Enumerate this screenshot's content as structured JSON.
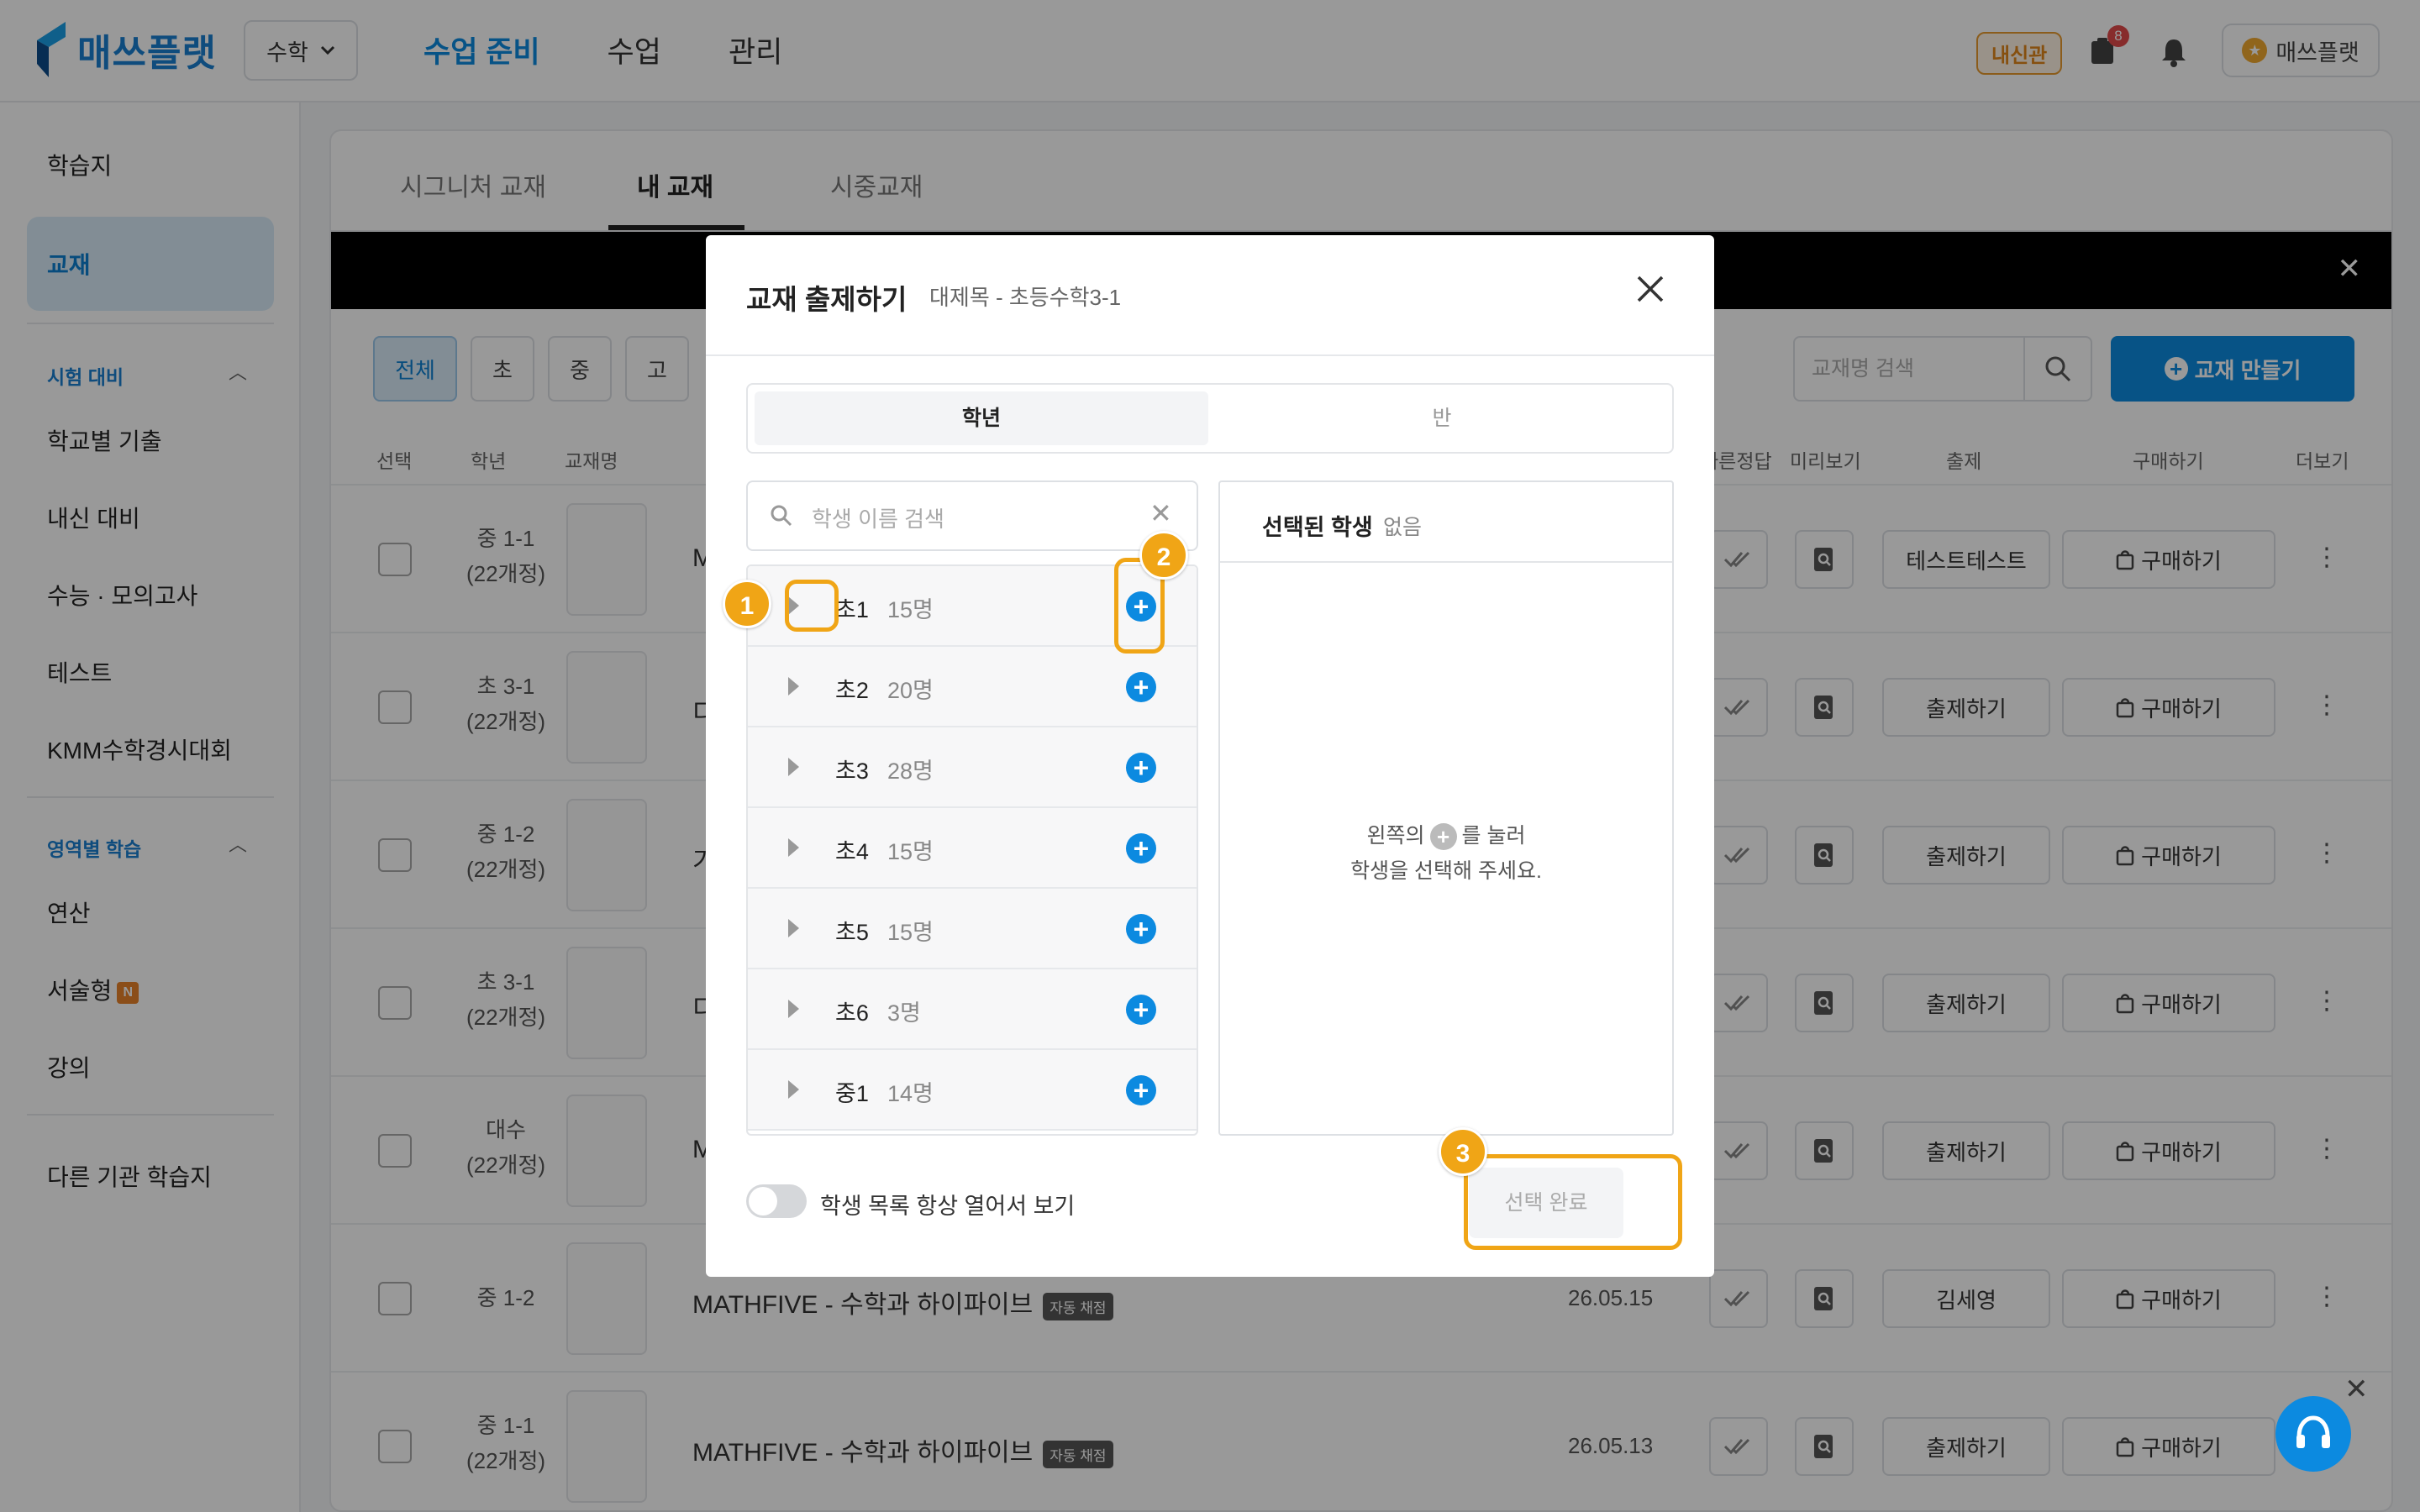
{
  "header": {
    "brand": "매쓰플랫",
    "subject": "수학",
    "nav": [
      "수업 준비",
      "수업",
      "관리"
    ],
    "badge_label": "내신관",
    "notification_count": "8",
    "user_name": "매쓰플랫",
    "colors": {
      "accent": "#0c8ae0",
      "brand": "#1a7fd0",
      "badge": "#e89a2e"
    }
  },
  "sidebar": {
    "top_items": [
      "학습지",
      "교재"
    ],
    "section_exam": "시험 대비",
    "exam_items": [
      "학교별 기출",
      "내신 대비",
      "수능 · 모의고사",
      "테스트",
      "KMM수학경시대회"
    ],
    "section_area": "영역별 학습",
    "area_items": [
      "연산",
      "서술형",
      "강의"
    ],
    "new_badge": "N",
    "bottom_item": "다른 기관 학습지"
  },
  "main": {
    "tabs": [
      "시그니처 교재",
      "내 교재",
      "시중교재"
    ],
    "filters": [
      "전체",
      "초",
      "중",
      "고"
    ],
    "search_placeholder": "교재명 검색",
    "make_button": "교재 만들기",
    "columns": [
      "선택",
      "학년",
      "교재명",
      "빠른정답",
      "미리보기",
      "출제",
      "구매하기",
      "더보기"
    ],
    "rows": [
      {
        "grade": "중 1-1",
        "sub": "(22개정)",
        "name": "M",
        "date": "",
        "assign": "테스트테스트",
        "buy": "구매하기",
        "auto": ""
      },
      {
        "grade": "초 3-1",
        "sub": "(22개정)",
        "name": "디",
        "date": "",
        "assign": "출제하기",
        "buy": "구매하기",
        "auto": ""
      },
      {
        "grade": "중 1-2",
        "sub": "(22개정)",
        "name": "기",
        "date": "",
        "assign": "출제하기",
        "buy": "구매하기",
        "auto": ""
      },
      {
        "grade": "초 3-1",
        "sub": "(22개정)",
        "name": "디",
        "date": "",
        "assign": "출제하기",
        "buy": "구매하기",
        "auto": ""
      },
      {
        "grade": "대수",
        "sub": "(22개정)",
        "name": "M",
        "date": "",
        "assign": "출제하기",
        "buy": "구매하기",
        "auto": ""
      },
      {
        "grade": "중 1-2",
        "sub": "",
        "name": "MATHFIVE - 수학과 하이파이브",
        "date": "26.05.15",
        "assign": "김세영",
        "buy": "구매하기",
        "auto": "자동 채점"
      },
      {
        "grade": "중 1-1",
        "sub": "(22개정)",
        "name": "MATHFIVE - 수학과 하이파이브",
        "date": "26.05.13",
        "assign": "출제하기",
        "buy": "구매하기",
        "auto": "자동 채점"
      }
    ]
  },
  "modal": {
    "title": "교재 출제하기",
    "subtitle": "대제목 - 초등수학3-1",
    "seg_grade": "학년",
    "seg_class": "반",
    "search_placeholder": "학생 이름 검색",
    "groups": [
      {
        "name": "초1",
        "count": "15명"
      },
      {
        "name": "초2",
        "count": "20명"
      },
      {
        "name": "초3",
        "count": "28명"
      },
      {
        "name": "초4",
        "count": "15명"
      },
      {
        "name": "초5",
        "count": "15명"
      },
      {
        "name": "초6",
        "count": "3명"
      },
      {
        "name": "중1",
        "count": "14명"
      }
    ],
    "selected_title": "선택된 학생",
    "selected_none": "없음",
    "empty_line1_pre": "왼쪽의",
    "empty_line1_post": "를 눌러",
    "empty_line2": "학생을 선택해 주세요.",
    "toggle_label": "학생 목록 항상 열어서 보기",
    "done_button": "선택 완료"
  },
  "annotations": [
    "1",
    "2",
    "3"
  ]
}
